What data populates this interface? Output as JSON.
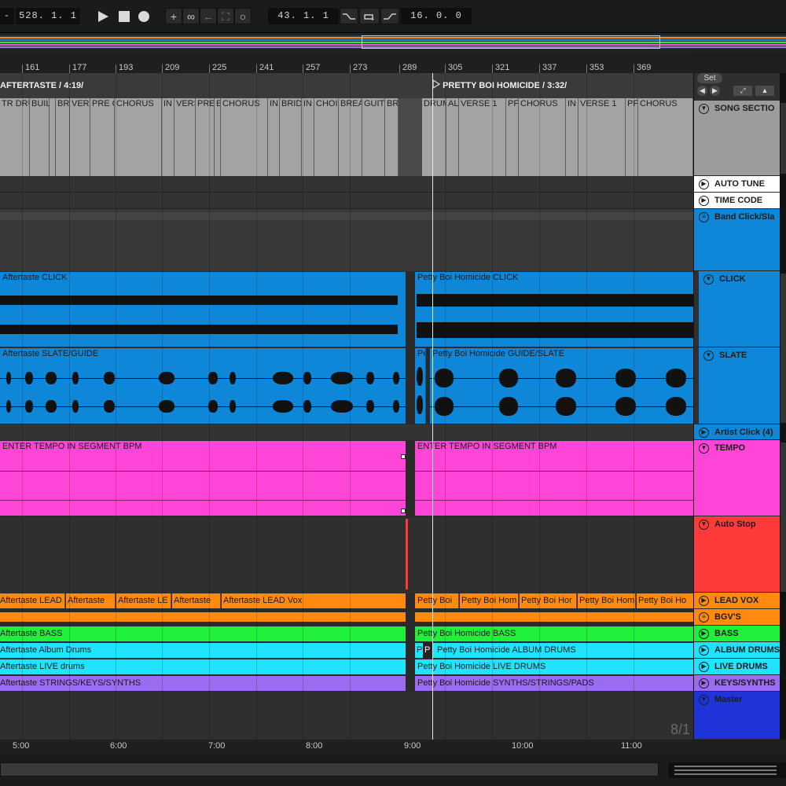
{
  "transport": {
    "position": "528.  1.  1",
    "loop_start": "43.  1.  1",
    "loop_length": "16.  0.  0"
  },
  "ruler": {
    "bars": [
      "161",
      "177",
      "193",
      "209",
      "225",
      "241",
      "257",
      "273",
      "289",
      "305",
      "321",
      "337",
      "353",
      "369"
    ]
  },
  "songs": [
    {
      "title": "AFTERTASTE / 4:19/"
    },
    {
      "title": "PRETTY BOI HOMICIDE / 3:32/"
    }
  ],
  "sections": {
    "song1": [
      "TR DRUM",
      "BUIL",
      "",
      "BR",
      "VERS",
      "PRE C",
      "CHORUS",
      "IN",
      "VERS",
      "PRE",
      "E",
      "CHORUS",
      "IN",
      "BRID",
      "IN",
      "CHOI",
      "BREA",
      "GUIT",
      "BR"
    ],
    "song2": [
      "DRUM",
      "AL",
      "VERSE 1",
      "PF",
      "CHORUS",
      "IN",
      "VERSE 1",
      "PF",
      "CHORUS"
    ]
  },
  "clips": {
    "click1": "Aftertaste CLICK",
    "click2": "Petty Boi Homicide CLICK",
    "slate1": "Aftertaste SLATE/GUIDE",
    "slate2a": "Pe",
    "slate2b": "Petty Boi Homicide GUIDE/SLATE",
    "tempo1": "ENTER TEMPO IN SEGMENT BPM",
    "tempo2": "ENTER TEMPO IN SEGMENT BPM",
    "lead1": [
      "Aftertaste LEAD Vo",
      "Aftertaste",
      "Aftertaste LE",
      "Aftertaste",
      "Aftertaste LEAD Vox"
    ],
    "lead2": [
      "Petty Boi",
      "Petty Boi Hom",
      "Petty Boi Hor",
      "Petty Boi Hom",
      "Petty Boi Ho"
    ],
    "bass1": "Aftertaste BASS",
    "bass2": "Petty Boi Homicide BASS",
    "drums1": "Aftertaste Album Drums",
    "drums2a": "P",
    "drums2b": "P",
    "drums2c": "Petty Boi Homicide ALBUM DRUMS",
    "live1": "Aftertaste LIVE drums",
    "live2": "Petty Boi Homicide LIVE DRUMS",
    "keys1": "Aftertaste STRINGS/KEYS/SYNTHS",
    "keys2": "Petty Boi Homicide SYNTHS/STRINGS/PADS"
  },
  "tracks": [
    {
      "name": "SONG SECTIO",
      "color": "#9c9c9c",
      "icon": "fold-icon"
    },
    {
      "name": "AUTO TUNE",
      "color": "#ffffff",
      "icon": "play-icon"
    },
    {
      "name": "TIME CODE",
      "color": "#ffffff",
      "icon": "play-icon"
    },
    {
      "name": "Band Click/Sla",
      "color": "#0f87d8",
      "icon": "list-icon"
    },
    {
      "name": "CLICK",
      "color": "#0f87d8",
      "icon": "fold-icon"
    },
    {
      "name": "SLATE",
      "color": "#0f87d8",
      "icon": "fold-icon"
    },
    {
      "name": "Artist Click (4)",
      "color": "#0f87d8",
      "icon": "play-icon"
    },
    {
      "name": "TEMPO",
      "color": "#ff44d8",
      "icon": "fold-icon"
    },
    {
      "name": "Auto Stop",
      "color": "#ff3a3a",
      "icon": "fold-icon"
    },
    {
      "name": "LEAD VOX",
      "color": "#ff8a0f",
      "icon": "play-icon"
    },
    {
      "name": "BGV'S",
      "color": "#ff8a0f",
      "icon": "list-icon"
    },
    {
      "name": "BASS",
      "color": "#1ff03a",
      "icon": "play-icon"
    },
    {
      "name": "ALBUM DRUMS",
      "color": "#1ee4ff",
      "icon": "play-icon"
    },
    {
      "name": "LIVE DRUMS",
      "color": "#1ee4ff",
      "icon": "play-icon"
    },
    {
      "name": "KEYS/SYNTHS",
      "color": "#9a6cf0",
      "icon": "play-icon"
    },
    {
      "name": "Master",
      "color": "#1e34d8",
      "icon": "fold-icon"
    }
  ],
  "panel": {
    "set_label": "Set",
    "meter": "8/1"
  },
  "time_ruler": [
    "5:00",
    "6:00",
    "7:00",
    "8:00",
    "9:00",
    "10:00",
    "11:00"
  ]
}
